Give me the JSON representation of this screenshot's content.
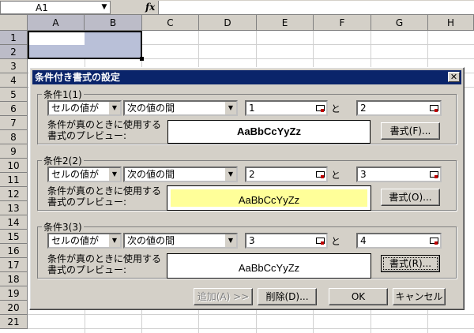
{
  "formula_bar": {
    "name_box": "A1",
    "fx_label": "fx"
  },
  "sheet": {
    "columns": [
      "A",
      "B",
      "C",
      "D",
      "E",
      "F",
      "G",
      "H"
    ],
    "rows": [
      "1",
      "2",
      "3",
      "4",
      "5",
      "6",
      "7",
      "8",
      "9",
      "10",
      "11",
      "12",
      "13",
      "14",
      "15",
      "16",
      "17",
      "18",
      "19",
      "20",
      "21"
    ]
  },
  "dialog": {
    "title": "条件付き書式の設定",
    "close_label": "✕",
    "conditions": [
      {
        "label": "条件1(1)",
        "type": "セルの値が",
        "operator": "次の値の間",
        "value1": "1",
        "and_label": "と",
        "value2": "2",
        "preview_label": "条件が真のときに使用する書式のプレビュー:",
        "preview_text": "AaBbCcYyZz",
        "format_button": "書式(F)..."
      },
      {
        "label": "条件2(2)",
        "type": "セルの値が",
        "operator": "次の値の間",
        "value1": "2",
        "and_label": "と",
        "value2": "3",
        "preview_label": "条件が真のときに使用する書式のプレビュー:",
        "preview_text": "AaBbCcYyZz",
        "format_button": "書式(O)..."
      },
      {
        "label": "条件3(3)",
        "type": "セルの値が",
        "operator": "次の値の間",
        "value1": "3",
        "and_label": "と",
        "value2": "4",
        "preview_label": "条件が真のときに使用する書式のプレビュー:",
        "preview_text": "AaBbCcYyZz",
        "format_button": "書式(R)..."
      }
    ],
    "buttons": {
      "add": "追加(A) >>",
      "delete": "削除(D)...",
      "ok": "OK",
      "cancel": "キャンセル"
    }
  },
  "colors": {
    "dialog_title_bg": "#0a246a",
    "preview2_bg": "#ffff99",
    "selection_fill": "#b9c0d8"
  }
}
